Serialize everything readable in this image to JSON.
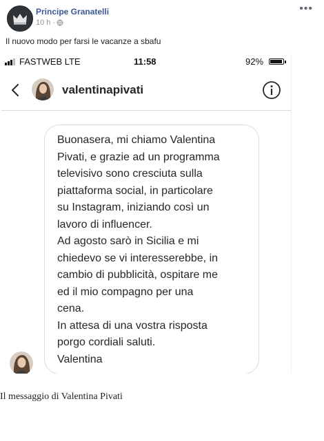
{
  "post": {
    "author": "Principe Granatelli",
    "time": "10 h ·",
    "text": "Il nuovo modo per farsi le vacanze a sbafu",
    "more_icon": "more-dots-icon",
    "audience_icon": "globe-icon"
  },
  "phone": {
    "carrier": "FASTWEB  LTE",
    "time": "11:58",
    "battery": "92%",
    "battery_level": 0.92
  },
  "chat": {
    "username": "valentinapivati",
    "message_paragraphs": [
      "Buonasera, mi chiamo Valentina\nPivati, e grazie ad un programma\ntelevisivo sono cresciuta sulla\npiattaforma social, in particolare\nsu Instagram, iniziando così un\nlavoro di influencer.",
      "Ad agosto sarò in Sicilia e mi\nchiedevo se vi interesserebbe, in\ncambio di pubblicità, ospitare me\ned il mio compagno per una\ncena.",
      "In attesa di una vostra risposta\nporgo cordiali saluti.",
      "Valentina"
    ]
  },
  "caption": "Il messaggio di Valentina Pivati",
  "colors": {
    "author": "#385898",
    "meta": "#90949c",
    "bubble_border": "#dbdbdb",
    "text": "#262626"
  }
}
